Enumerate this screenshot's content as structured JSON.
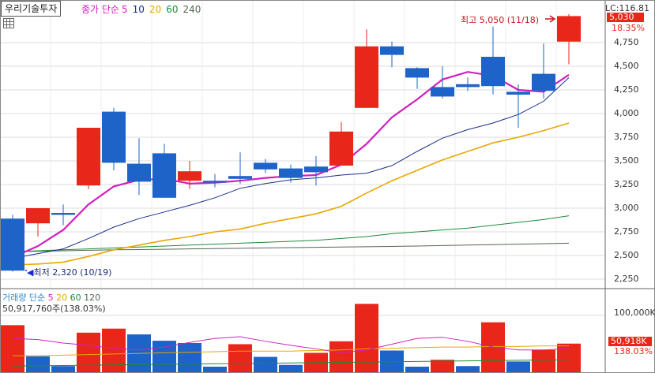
{
  "header": {
    "stock_name": "우리기술투자",
    "price_ma_title": "종가 단순",
    "price_ma_periods": [
      "5",
      "10",
      "20",
      "60",
      "240"
    ],
    "price_ma_colors": [
      "#d020c0",
      "#1a2f8a",
      "#e8a800",
      "#1e8a3a",
      "#556655"
    ]
  },
  "price_axis": {
    "top_label": "LC:116.81",
    "current_value": "5,030",
    "current_pct": "18.35%",
    "ticks": [
      "4,750",
      "4,500",
      "4,250",
      "4,000",
      "3,750",
      "3,500",
      "3,250",
      "3,000",
      "2,750",
      "2,500",
      "2,250"
    ],
    "tick_values": [
      4750,
      4500,
      4250,
      4000,
      3750,
      3500,
      3250,
      3000,
      2750,
      2500,
      2250
    ]
  },
  "annotations": {
    "high": "최고 5,050 (11/18)",
    "low": "최저 2,320 (10/19)"
  },
  "volume_panel": {
    "title": "거래량 단순",
    "ma_periods": [
      "5",
      "20",
      "60",
      "120"
    ],
    "ma_colors": [
      "#d020c0",
      "#e8a800",
      "#1e8a3a",
      "#556655"
    ],
    "volume_readout": "50,917,760주(138.03%)",
    "axis_tick": "100,000K",
    "current_value": "50,918K",
    "current_pct": "138.03%"
  },
  "chart_data": {
    "type": "candlestick",
    "ylim": [
      2150,
      5150
    ],
    "candles": [
      {
        "o": 2890,
        "h": 2930,
        "l": 2330,
        "c": 2340,
        "up": false
      },
      {
        "o": 2840,
        "h": 3000,
        "l": 2700,
        "c": 3000,
        "up": true
      },
      {
        "o": 2950,
        "h": 3040,
        "l": 2820,
        "c": 2930,
        "up": false
      },
      {
        "o": 3240,
        "h": 3850,
        "l": 3200,
        "c": 3850,
        "up": true
      },
      {
        "o": 4020,
        "h": 4060,
        "l": 3400,
        "c": 3480,
        "up": false
      },
      {
        "o": 3470,
        "h": 3740,
        "l": 3140,
        "c": 3280,
        "up": false
      },
      {
        "o": 3580,
        "h": 3680,
        "l": 3120,
        "c": 3110,
        "up": false
      },
      {
        "o": 3290,
        "h": 3500,
        "l": 3200,
        "c": 3390,
        "up": true
      },
      {
        "o": 3290,
        "h": 3360,
        "l": 3220,
        "c": 3270,
        "up": false
      },
      {
        "o": 3340,
        "h": 3590,
        "l": 3260,
        "c": 3310,
        "up": false
      },
      {
        "o": 3480,
        "h": 3520,
        "l": 3370,
        "c": 3410,
        "up": false
      },
      {
        "o": 3420,
        "h": 3460,
        "l": 3270,
        "c": 3320,
        "up": false
      },
      {
        "o": 3440,
        "h": 3550,
        "l": 3240,
        "c": 3380,
        "up": false
      },
      {
        "o": 3450,
        "h": 3910,
        "l": 3450,
        "c": 3810,
        "up": true
      },
      {
        "o": 4060,
        "h": 4890,
        "l": 4060,
        "c": 4710,
        "up": true
      },
      {
        "o": 4710,
        "h": 4760,
        "l": 4490,
        "c": 4620,
        "up": false
      },
      {
        "o": 4480,
        "h": 4490,
        "l": 4260,
        "c": 4380,
        "up": false
      },
      {
        "o": 4280,
        "h": 4500,
        "l": 4160,
        "c": 4180,
        "up": false
      },
      {
        "o": 4280,
        "h": 4380,
        "l": 4240,
        "c": 4310,
        "up": false
      },
      {
        "o": 4600,
        "h": 4920,
        "l": 4200,
        "c": 4290,
        "up": false
      },
      {
        "o": 4230,
        "h": 4310,
        "l": 3850,
        "c": 4200,
        "up": false
      },
      {
        "o": 4420,
        "h": 4740,
        "l": 4160,
        "c": 4240,
        "up": false
      },
      {
        "o": 4760,
        "h": 5050,
        "l": 4520,
        "c": 5030,
        "up": true
      }
    ],
    "ma5": [
      2480,
      2600,
      2770,
      3040,
      3230,
      3300,
      3310,
      3260,
      3270,
      3290,
      3320,
      3340,
      3350,
      3460,
      3680,
      3960,
      4150,
      4360,
      4440,
      4400,
      4250,
      4230,
      4410
    ],
    "ma10": [
      2470,
      2520,
      2570,
      2680,
      2800,
      2890,
      2960,
      3030,
      3110,
      3210,
      3260,
      3300,
      3320,
      3350,
      3370,
      3450,
      3600,
      3740,
      3830,
      3900,
      3990,
      4130,
      4380
    ],
    "ma20": [
      2400,
      2410,
      2430,
      2490,
      2560,
      2610,
      2660,
      2700,
      2750,
      2780,
      2840,
      2890,
      2940,
      3020,
      3160,
      3290,
      3400,
      3510,
      3600,
      3690,
      3750,
      3820,
      3900
    ],
    "ma60": [
      2540,
      2550,
      2560,
      2570,
      2580,
      2590,
      2600,
      2610,
      2620,
      2630,
      2640,
      2650,
      2660,
      2680,
      2700,
      2730,
      2750,
      2770,
      2790,
      2820,
      2850,
      2880,
      2920
    ],
    "ma240": [
      2540,
      2545,
      2550,
      2555,
      2560,
      2563,
      2566,
      2570,
      2573,
      2576,
      2580,
      2583,
      2586,
      2590,
      2593,
      2596,
      2600,
      2605,
      2610,
      2615,
      2620,
      2625,
      2630
    ],
    "volume_ylim": [
      0,
      130000
    ],
    "volumes": [
      {
        "v": 83000,
        "up": true
      },
      {
        "v": 29000,
        "up": false
      },
      {
        "v": 12000,
        "up": false
      },
      {
        "v": 70000,
        "up": true
      },
      {
        "v": 77000,
        "up": true
      },
      {
        "v": 67000,
        "up": false
      },
      {
        "v": 56000,
        "up": false
      },
      {
        "v": 52000,
        "up": false
      },
      {
        "v": 11000,
        "up": false
      },
      {
        "v": 50000,
        "up": true
      },
      {
        "v": 28000,
        "up": false
      },
      {
        "v": 14000,
        "up": false
      },
      {
        "v": 35000,
        "up": true
      },
      {
        "v": 55000,
        "up": true
      },
      {
        "v": 120000,
        "up": true
      },
      {
        "v": 39000,
        "up": false
      },
      {
        "v": 11000,
        "up": false
      },
      {
        "v": 23000,
        "up": true
      },
      {
        "v": 12000,
        "up": false
      },
      {
        "v": 88000,
        "up": true
      },
      {
        "v": 20000,
        "up": false
      },
      {
        "v": 40000,
        "up": true
      },
      {
        "v": 51000,
        "up": true
      }
    ],
    "vol_ma5": [
      60000,
      58000,
      52000,
      48000,
      43000,
      40000,
      45000,
      53000,
      60000,
      63000,
      55000,
      48000,
      42000,
      35000,
      40000,
      50000,
      60000,
      62000,
      55000,
      45000,
      40000,
      40000,
      42000
    ],
    "vol_ma20": [
      30000,
      30000,
      31000,
      32000,
      33000,
      34000,
      35000,
      36000,
      37000,
      38000,
      38000,
      38000,
      39000,
      40000,
      42000,
      43000,
      44000,
      45000,
      45000,
      46000,
      46000,
      47000,
      47000
    ],
    "vol_ma60": [
      12000,
      12500,
      13000,
      13500,
      14000,
      14500,
      15000,
      15500,
      16000,
      16500,
      17000,
      17500,
      18000,
      18500,
      19000,
      19500,
      20000,
      20500,
      21000,
      21500,
      22000,
      22500,
      23000
    ]
  }
}
